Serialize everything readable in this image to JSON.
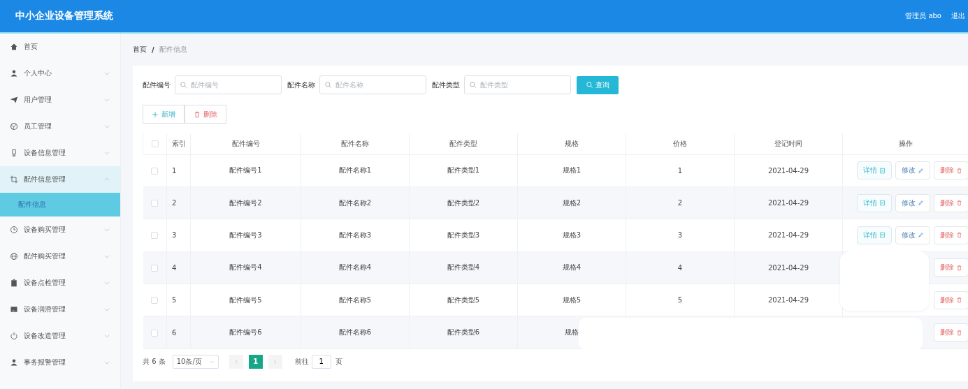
{
  "header": {
    "title": "中小企业设备管理系统",
    "user": "管理员 abo",
    "logout": "退出"
  },
  "sidebar": {
    "items": [
      {
        "label": "首页",
        "kind": "link",
        "expanded": false
      },
      {
        "label": "个人中心",
        "kind": "group",
        "expanded": false
      },
      {
        "label": "用户管理",
        "kind": "group",
        "expanded": false
      },
      {
        "label": "员工管理",
        "kind": "group",
        "expanded": false
      },
      {
        "label": "设备信息管理",
        "kind": "group",
        "expanded": false
      },
      {
        "label": "配件信息管理",
        "kind": "group",
        "expanded": true,
        "children": [
          {
            "label": "配件信息",
            "selected": true
          }
        ]
      },
      {
        "label": "设备购买管理",
        "kind": "group",
        "expanded": false
      },
      {
        "label": "配件购买管理",
        "kind": "group",
        "expanded": false
      },
      {
        "label": "设备点检管理",
        "kind": "group",
        "expanded": false
      },
      {
        "label": "设备润滑管理",
        "kind": "group",
        "expanded": false
      },
      {
        "label": "设备改造管理",
        "kind": "group",
        "expanded": false
      },
      {
        "label": "事务报警管理",
        "kind": "group",
        "expanded": false
      }
    ]
  },
  "breadcrumb": {
    "items": [
      "首页",
      "配件信息"
    ],
    "separator": "/"
  },
  "search": {
    "fields": [
      {
        "label": "配件编号",
        "placeholder": "配件编号"
      },
      {
        "label": "配件名称",
        "placeholder": "配件名称"
      },
      {
        "label": "配件类型",
        "placeholder": "配件类型"
      }
    ],
    "button": "查询"
  },
  "toolbar": [
    {
      "label": "新增",
      "kind": "add"
    },
    {
      "label": "删除",
      "kind": "delete"
    }
  ],
  "table": {
    "all_checked": false,
    "columns": [
      "索引",
      "配件编号",
      "配件名称",
      "配件类型",
      "规格",
      "价格",
      "登记时间",
      "操作"
    ],
    "rows": [
      {
        "checked": false,
        "cells": [
          "1",
          "配件编号1",
          "配件名称1",
          "配件类型1",
          "规格1",
          "1",
          "2021-04-29"
        ],
        "actions": [
          {
            "label": "详情",
            "kind": "detail"
          },
          {
            "label": "修改",
            "kind": "edit"
          },
          {
            "label": "删除",
            "kind": "delete"
          }
        ]
      },
      {
        "checked": false,
        "cells": [
          "2",
          "配件编号2",
          "配件名称2",
          "配件类型2",
          "规格2",
          "2",
          "2021-04-29"
        ],
        "actions": [
          {
            "label": "详情",
            "kind": "detail"
          },
          {
            "label": "修改",
            "kind": "edit"
          },
          {
            "label": "删除",
            "kind": "delete"
          }
        ]
      },
      {
        "checked": false,
        "cells": [
          "3",
          "配件编号3",
          "配件名称3",
          "配件类型3",
          "规格3",
          "3",
          "2021-04-29"
        ],
        "actions": [
          {
            "label": "详情",
            "kind": "detail"
          },
          {
            "label": "修改",
            "kind": "edit"
          },
          {
            "label": "删除",
            "kind": "delete"
          }
        ]
      },
      {
        "checked": false,
        "cells": [
          "4",
          "配件编号4",
          "配件名称4",
          "配件类型4",
          "规格4",
          "4",
          "2021-04-29"
        ],
        "actions": [
          {
            "label": "删除",
            "kind": "delete"
          }
        ]
      },
      {
        "checked": false,
        "cells": [
          "5",
          "配件编号5",
          "配件名称5",
          "配件类型5",
          "规格5",
          "5",
          "2021-04-29"
        ],
        "actions": [
          {
            "label": "删除",
            "kind": "delete"
          }
        ]
      },
      {
        "checked": false,
        "cells": [
          "6",
          "配件编号6",
          "配件名称6",
          "配件类型6",
          "规格"
        ],
        "actions": [
          {
            "label": "删除",
            "kind": "delete"
          }
        ]
      }
    ]
  },
  "pagination": {
    "total": "共 6 条",
    "page_size": "10条/页",
    "pages": [
      {
        "label": "1",
        "selected": true
      }
    ],
    "goto": "前往",
    "goto_value": "1",
    "goto_unit": "页"
  }
}
